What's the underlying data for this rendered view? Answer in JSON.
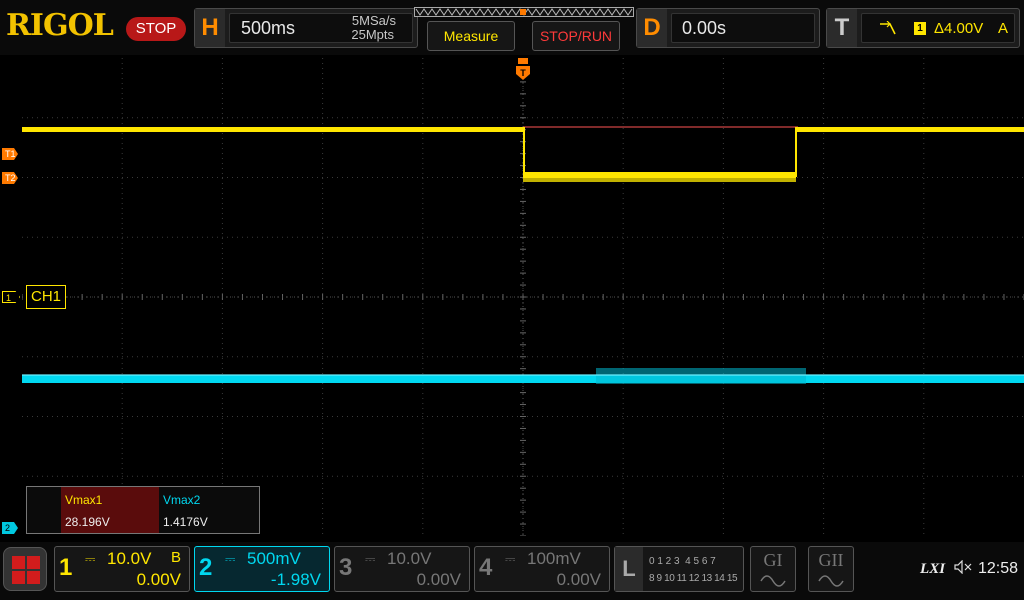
{
  "brand": "RIGOL",
  "run_state": "STOP",
  "horizontal": {
    "tag": "H",
    "timebase": "500ms",
    "sample_rate": "5MSa/s",
    "memory_depth": "25Mpts"
  },
  "buttons": {
    "measure": "Measure",
    "stop_run": "STOP/RUN"
  },
  "delay": {
    "tag": "D",
    "value": "0.00s"
  },
  "trigger": {
    "tag": "T",
    "source_badge": "1",
    "level": "Δ4.00V",
    "mode": "A"
  },
  "markers": {
    "trigger_top": "T",
    "t1": "T1",
    "t2": "T2",
    "ch1": "1",
    "ch2": "2"
  },
  "ch1_label": "CH1",
  "measurements": [
    {
      "name": "Vmax1",
      "value": "28.196V"
    },
    {
      "name": "Vmax2",
      "value": "1.4176V"
    }
  ],
  "channels": [
    {
      "num": "1",
      "coupling": "⎓",
      "scale": "10.0V",
      "bw": "B",
      "offset": "0.00V",
      "color": "#ffe600",
      "active": false
    },
    {
      "num": "2",
      "coupling": "⎓",
      "scale": "500mV",
      "bw": "",
      "offset": "-1.98V",
      "color": "#00d8f0",
      "active": true
    },
    {
      "num": "3",
      "coupling": "⎓",
      "scale": "10.0V",
      "bw": "",
      "offset": "0.00V",
      "color": "#777777",
      "active": false
    },
    {
      "num": "4",
      "coupling": "⎓",
      "scale": "100mV",
      "bw": "",
      "offset": "0.00V",
      "color": "#777777",
      "active": false
    }
  ],
  "logic": {
    "tag": "L",
    "row1": "0 1 2 3  4 5 6 7",
    "row2": "8 9 10 11 12 13 14 15"
  },
  "generators": [
    {
      "label": "GI"
    },
    {
      "label": "GII"
    }
  ],
  "status": {
    "lxi": "LXI",
    "time": "12:58"
  },
  "colors": {
    "ch1": "#ffe600",
    "ch2": "#00d8f0",
    "marker": "#ff7a00",
    "stop": "#b81818"
  }
}
